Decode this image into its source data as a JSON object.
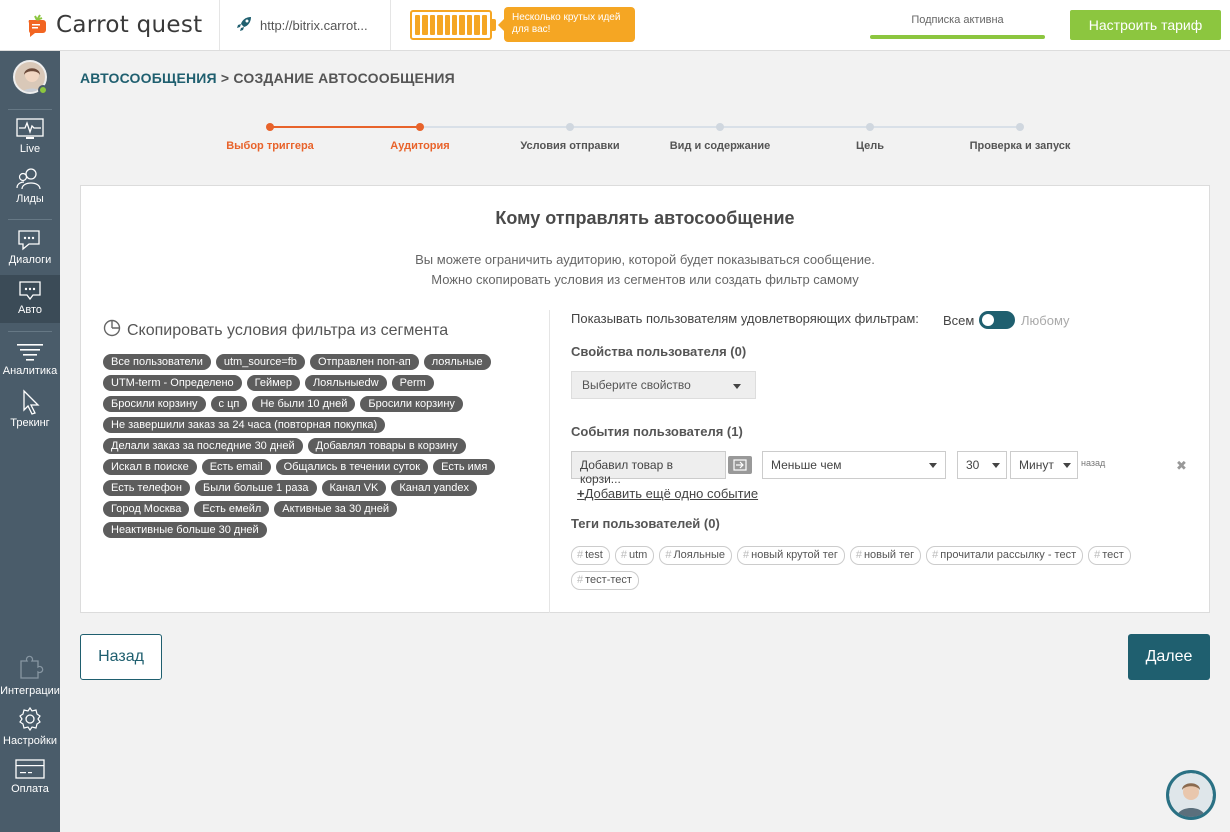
{
  "topbar": {
    "brand": "Carrot quest",
    "site_url": "http://bitrix.carrot...",
    "ideas_text": "Несколько крутых идей для вас!",
    "subscription_status": "Подписка активна",
    "tariff_button": "Настроить тариф",
    "accent_green": "#8cc63f",
    "accent_orange": "#f5a623"
  },
  "sidebar": {
    "items": [
      {
        "label": "Live",
        "icon": "pulse-icon"
      },
      {
        "label": "Лиды",
        "icon": "users-icon"
      },
      {
        "label": "Диалоги",
        "icon": "chat-icon"
      },
      {
        "label": "Авто",
        "icon": "auto-message-icon",
        "active": true
      },
      {
        "label": "Аналитика",
        "icon": "funnel-icon"
      },
      {
        "label": "Трекинг",
        "icon": "cursor-icon"
      },
      {
        "label": "Интеграции",
        "icon": "puzzle-icon"
      },
      {
        "label": "Настройки",
        "icon": "gear-icon"
      },
      {
        "label": "Оплата",
        "icon": "card-icon"
      }
    ]
  },
  "breadcrumb": {
    "parent": "АВТОСООБЩЕНИЯ",
    "separator": " > ",
    "current": "СОЗДАНИЕ АВТОСООБЩЕНИЯ"
  },
  "steps": [
    {
      "label": "Выбор триггера",
      "state": "done"
    },
    {
      "label": "Аудитория",
      "state": "current"
    },
    {
      "label": "Условия отправки",
      "state": "todo"
    },
    {
      "label": "Вид и содержание",
      "state": "todo"
    },
    {
      "label": "Цель",
      "state": "todo"
    },
    {
      "label": "Проверка и запуск",
      "state": "todo"
    }
  ],
  "card": {
    "title": "Кому отправлять автосообщение",
    "desc_line1": "Вы можете ограничить аудиторию, которой будет показываться сообщение.",
    "desc_line2": "Можно скопировать условия из сегментов или создать фильтр самому"
  },
  "segments": {
    "heading": "Скопировать условия фильтра из сегмента",
    "tags": [
      "Все пользователи",
      "utm_source=fb",
      "Отправлен поп-ап",
      "лояльные",
      "UTM-term - Определено",
      "Геймер",
      "Лояльныеdw",
      "Perm",
      "Бросили корзину",
      "с цп",
      "Не были 10 дней",
      "Бросили корзину",
      "Не завершили заказ за 24 часа (повторная покупка)",
      "Делали заказ за последние 30 дней",
      "Добавлял товары в корзину",
      "Искал в поиске",
      "Есть email",
      "Общались в течении суток",
      "Есть имя",
      "Есть телефон",
      "Были больше 1 раза",
      "Канал VK",
      "Канал yandex",
      "Город Москва",
      "Есть емейл",
      "Активные за 30 дней",
      "Неактивные больше 30 дней"
    ]
  },
  "filters": {
    "label": "Показывать пользователям удовлетворяющих фильтрам:",
    "option_all": "Всем",
    "option_any": "Любому",
    "properties_label": "Свойства пользователя (0)",
    "property_placeholder": "Выберите свойство",
    "events_label": "События пользователя (1)",
    "event": {
      "name": "Добавил товар в корзи...",
      "condition": "Меньше чем",
      "amount": "30",
      "unit": "Минут",
      "suffix": "назад"
    },
    "add_event": "Добавить ещё одно событие",
    "tags_label": "Теги пользователей (0)",
    "user_tags": [
      "test",
      "utm",
      "Лояльные",
      "новый крутой тег",
      "новый тег",
      "прочитали рассылку - тест",
      "тест",
      "тест-тест"
    ]
  },
  "actions": {
    "back": "Назад",
    "next": "Далее"
  }
}
